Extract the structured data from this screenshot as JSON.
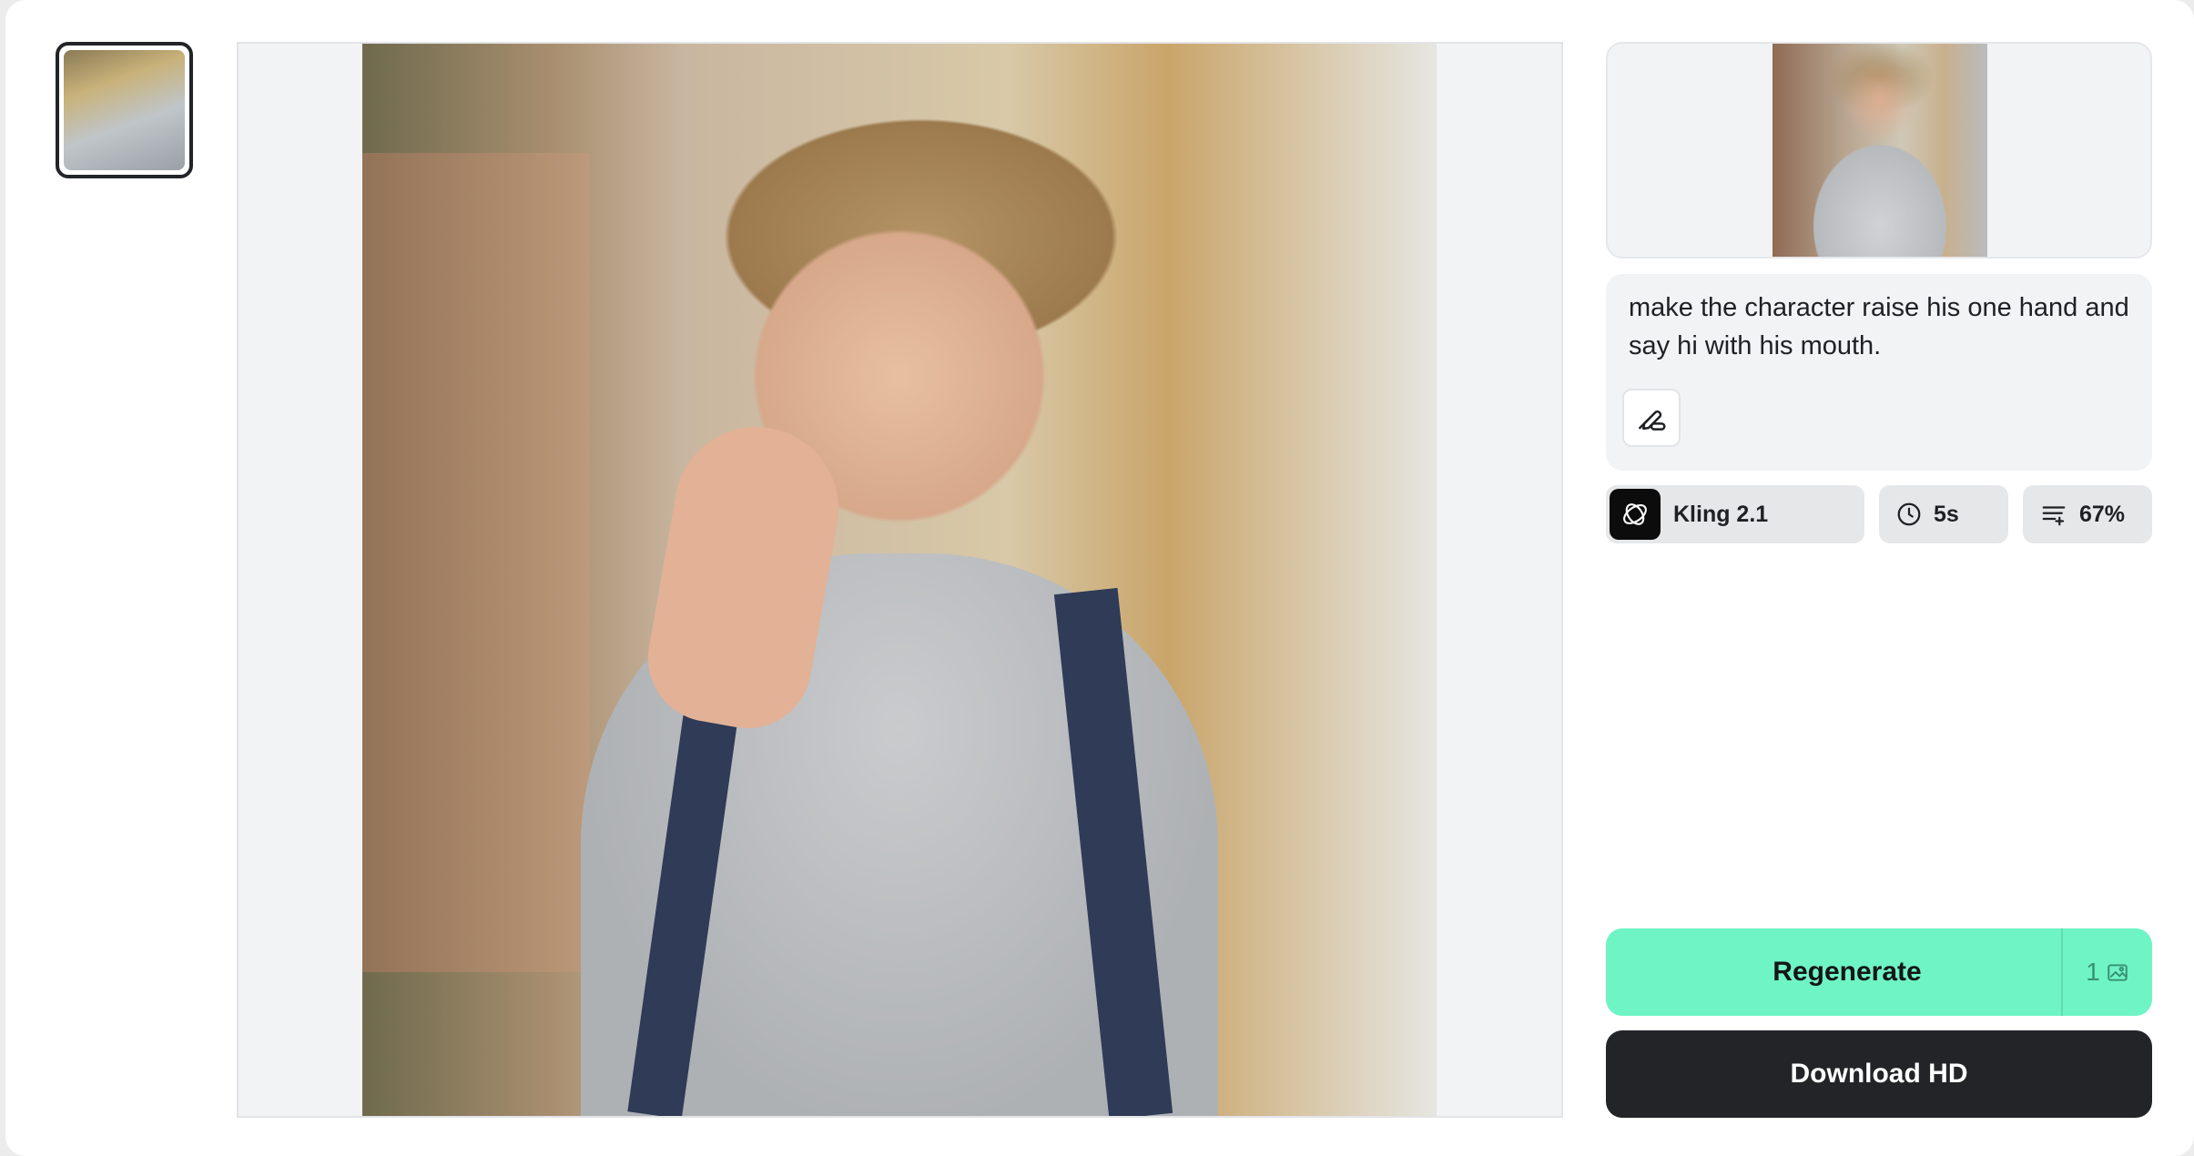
{
  "thumbnails": [
    {
      "name": "generated-video-thumbnail",
      "selected": true
    }
  ],
  "preview": {
    "description": "main-generated-image"
  },
  "reference": {
    "name": "reference-image"
  },
  "prompt": {
    "text": "make the character raise his one hand and say hi with his mouth.",
    "edit_icon": "edit-prompt-icon"
  },
  "settings": {
    "model": {
      "label": "Kling 2.1",
      "icon": "kling-logo-icon"
    },
    "duration": {
      "label": "5s",
      "icon": "clock-icon"
    },
    "strength": {
      "label": "67%",
      "icon": "strength-lines-icon"
    }
  },
  "actions": {
    "regenerate_label": "Regenerate",
    "regenerate_cost": "1",
    "download_label": "Download HD"
  },
  "colors": {
    "accent": "#6ff4c6",
    "dark": "#222428",
    "chip_bg": "#e6e7e9"
  }
}
